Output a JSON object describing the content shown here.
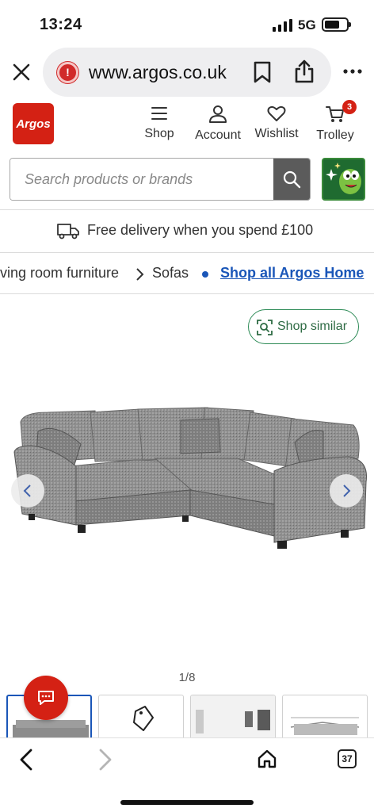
{
  "status": {
    "time": "13:24",
    "network": "5G",
    "battery_level": 0.7
  },
  "browser": {
    "url": "www.argos.co.uk",
    "tab_count": "37"
  },
  "header": {
    "logo": "Argos",
    "nav": [
      {
        "label": "Shop",
        "icon": "menu-icon"
      },
      {
        "label": "Account",
        "icon": "user-icon"
      },
      {
        "label": "Wishlist",
        "icon": "heart-icon"
      },
      {
        "label": "Trolley",
        "icon": "cart-icon",
        "badge": "3"
      }
    ]
  },
  "search": {
    "placeholder": "Search products or brands"
  },
  "delivery": {
    "text": "Free delivery when you spend £100"
  },
  "breadcrumb": {
    "items": [
      "ving room furniture",
      "Sofas"
    ],
    "shop_all": "Shop all Argos Home"
  },
  "gallery": {
    "shop_similar": "Shop similar",
    "counter": "1/8"
  },
  "colors": {
    "brand": "#d42114",
    "link": "#1a56b8",
    "accent_green": "#2e8b57"
  }
}
